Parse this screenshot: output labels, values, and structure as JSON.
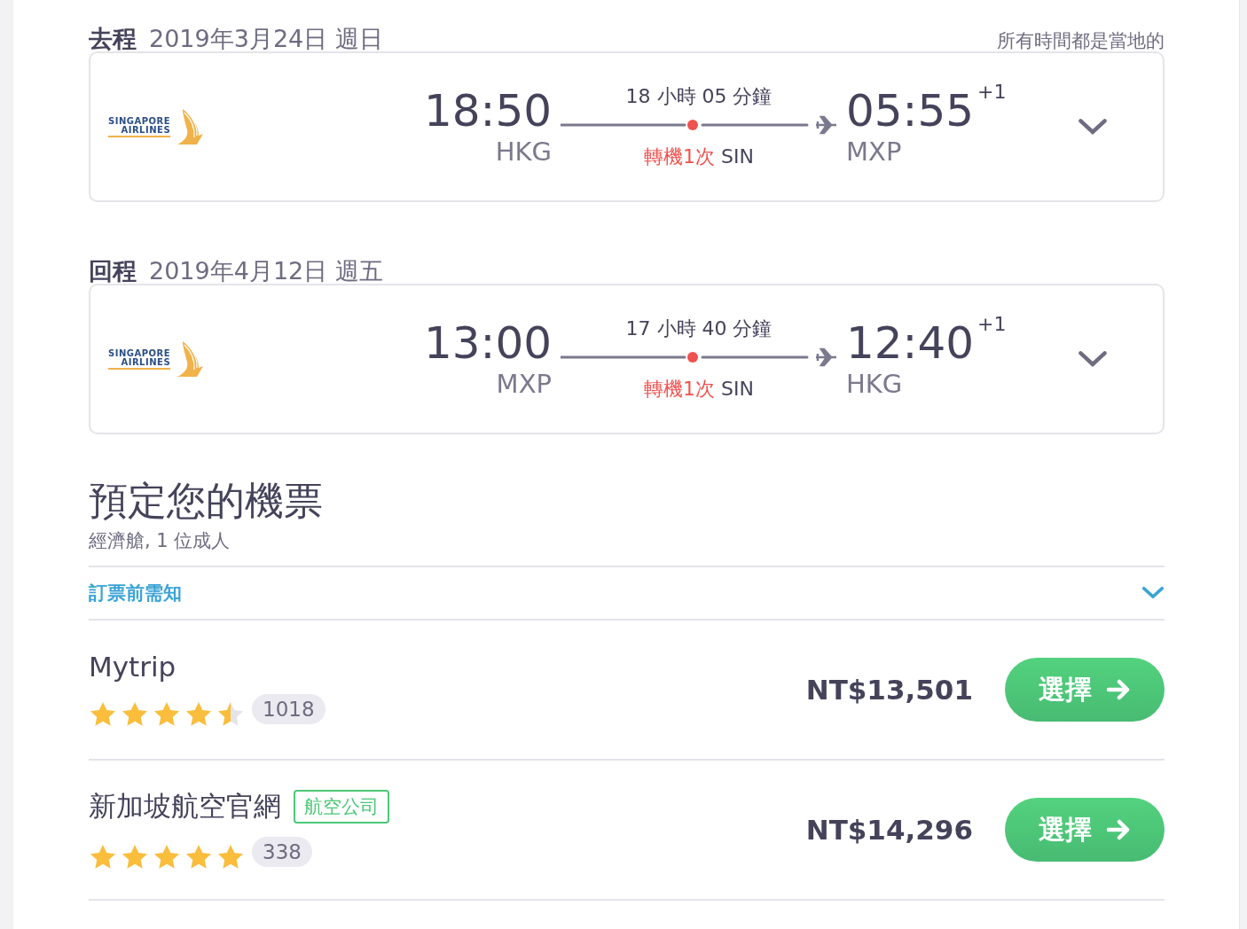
{
  "legs": [
    {
      "label": "去程",
      "date": "2019年3月24日 週日",
      "note": "所有時間都是當地的",
      "airline": {
        "logo_lines": [
          "SINGAPORE",
          "AIRLINES"
        ]
      },
      "depart_time": "18:50",
      "depart_airport": "HKG",
      "duration": "18 小時 05 分鐘",
      "stops": "轉機1次",
      "stop_airport": "SIN",
      "arrive_time": "05:55",
      "day_offset": "+1",
      "arrive_airport": "MXP",
      "expanded": false
    },
    {
      "label": "回程",
      "date": "2019年4月12日 週五",
      "airline": {
        "logo_lines": [
          "SINGAPORE",
          "AIRLINES"
        ]
      },
      "depart_time": "13:00",
      "depart_airport": "MXP",
      "duration": "17 小時 40 分鐘",
      "stops": "轉機1次",
      "stop_airport": "SIN",
      "arrive_time": "12:40",
      "day_offset": "+1",
      "arrive_airport": "HKG",
      "expanded": false
    }
  ],
  "booking": {
    "title": "預定您的機票",
    "subtitle": "經濟艙, 1 位成人",
    "notice": {
      "label": "訂票前需知",
      "expanded": false
    },
    "providers": [
      {
        "name": "Mytrip",
        "stars": 4.5,
        "reviews": "1018",
        "price": "NT$13,501",
        "button": "選擇"
      },
      {
        "name": "新加坡航空官網",
        "tag": "航空公司",
        "stars": 5,
        "reviews": "338",
        "price": "NT$14,296",
        "button": "選擇"
      }
    ]
  }
}
